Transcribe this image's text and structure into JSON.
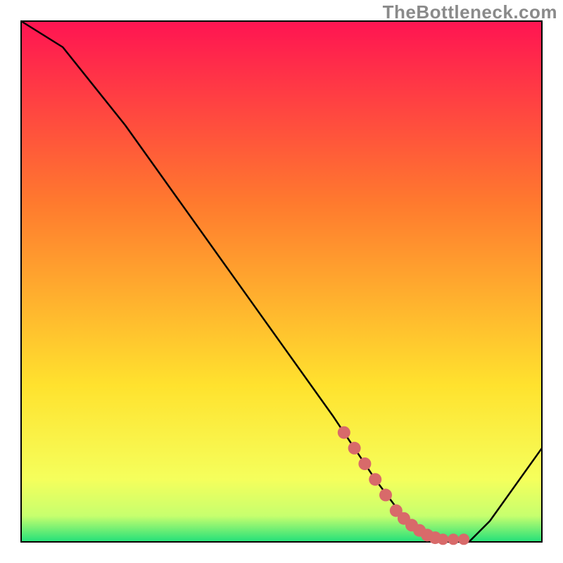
{
  "watermark": "TheBottleneck.com",
  "colors": {
    "gradient_top": "#ff1452",
    "gradient_mid1": "#ff7a2e",
    "gradient_mid2": "#ffe22e",
    "gradient_bottom1": "#f5ff5c",
    "gradient_bottom2": "#c7ff6e",
    "gradient_green": "#22e07a",
    "border": "#000000",
    "curve": "#000000",
    "marker": "#d86a6a"
  },
  "chart_data": {
    "type": "line",
    "title": "",
    "xlabel": "",
    "ylabel": "",
    "xlim": [
      0,
      100
    ],
    "ylim": [
      0,
      100
    ],
    "grid": false,
    "series": [
      {
        "name": "bottleneck-curve",
        "x": [
          0,
          8,
          20,
          30,
          40,
          50,
          60,
          68,
          74,
          78,
          82,
          86,
          90,
          100
        ],
        "y": [
          100,
          95,
          80,
          66,
          52,
          38,
          24,
          12,
          4,
          1,
          0,
          0,
          4,
          18
        ]
      }
    ],
    "markers": {
      "name": "highlight-segment",
      "x": [
        62,
        64,
        66,
        68,
        70,
        72,
        73.5,
        75,
        76.5,
        78,
        79.5,
        81,
        83,
        85
      ],
      "y": [
        21,
        18,
        15,
        12,
        9,
        6,
        4.5,
        3.2,
        2.2,
        1.3,
        0.8,
        0.5,
        0.5,
        0.5
      ]
    }
  }
}
